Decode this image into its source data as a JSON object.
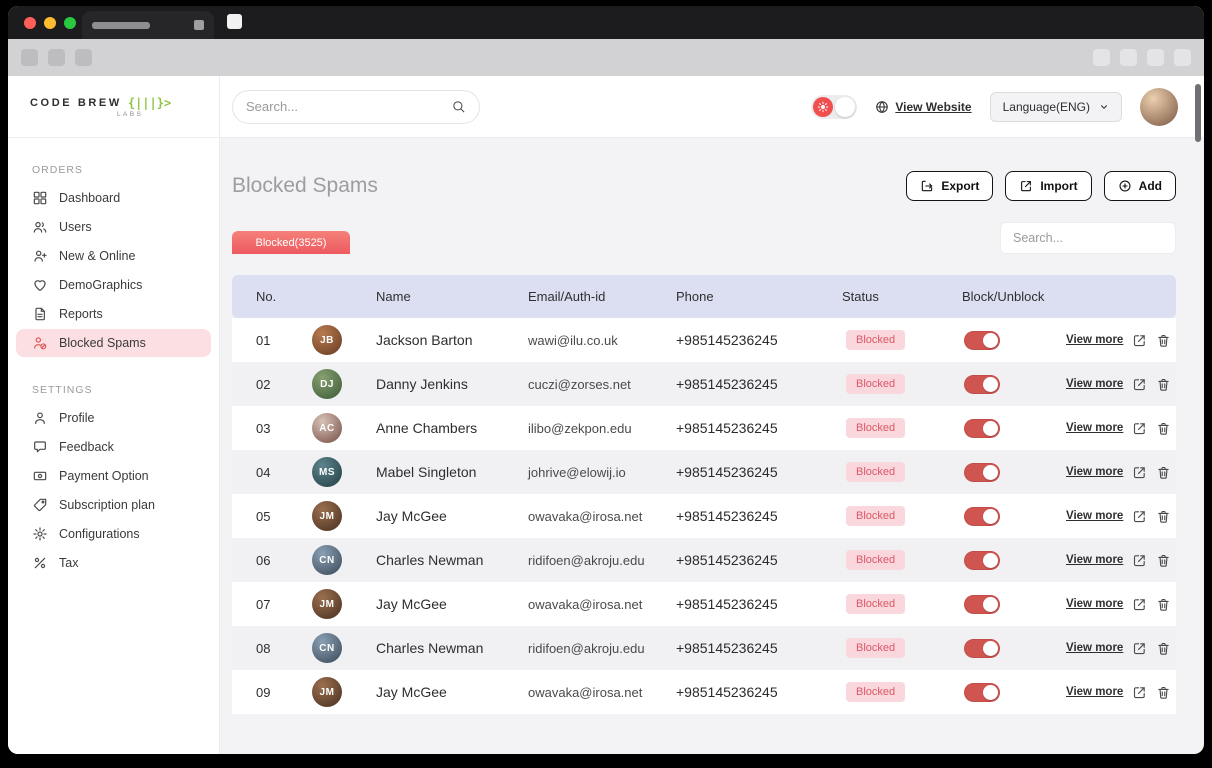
{
  "window": {
    "traffic_lights": [
      "close",
      "minimize",
      "zoom"
    ]
  },
  "sidebar": {
    "logo": {
      "text": "CODE BREW",
      "sub": "LABS",
      "mark": "{|||}>"
    },
    "sections": [
      {
        "label": "ORDERS",
        "items": [
          {
            "label": "Dashboard",
            "icon": "dashboard-icon",
            "active": false
          },
          {
            "label": "Users",
            "icon": "users-icon",
            "active": false
          },
          {
            "label": "New & Online",
            "icon": "user-plus-icon",
            "active": false
          },
          {
            "label": "DemoGraphics",
            "icon": "heart-icon",
            "active": false
          },
          {
            "label": "Reports",
            "icon": "report-icon",
            "active": false
          },
          {
            "label": "Blocked Spams",
            "icon": "user-block-icon",
            "active": true
          }
        ]
      },
      {
        "label": "SETTINGS",
        "items": [
          {
            "label": "Profile",
            "icon": "profile-icon",
            "active": false
          },
          {
            "label": "Feedback",
            "icon": "feedback-icon",
            "active": false
          },
          {
            "label": "Payment Option",
            "icon": "payment-icon",
            "active": false
          },
          {
            "label": "Subscription plan",
            "icon": "subscription-icon",
            "active": false
          },
          {
            "label": "Configurations",
            "icon": "configurations-icon",
            "active": false
          },
          {
            "label": "Tax",
            "icon": "tax-icon",
            "active": false
          }
        ]
      }
    ]
  },
  "topbar": {
    "search_placeholder": "Search...",
    "view_website": "View Website",
    "language": "Language(ENG)"
  },
  "page": {
    "title": "Blocked Spams",
    "export_label": "Export",
    "import_label": "Import",
    "add_label": "Add",
    "tab_label": "Blocked(3525)",
    "table_search_placeholder": "Search..."
  },
  "table": {
    "headers": {
      "no": "No.",
      "name": "Name",
      "email": "Email/Auth-id",
      "phone": "Phone",
      "status": "Status",
      "block": "Block/Unblock"
    },
    "view_more_label": "View more",
    "rows": [
      {
        "no": "01",
        "name": "Jackson Barton",
        "email": "wawi@ilu.co.uk",
        "phone": "+985145236245",
        "status": "Blocked",
        "avatar_bg": "#7a4a2e",
        "avatar_bg2": "#b97b4e"
      },
      {
        "no": "02",
        "name": "Danny Jenkins",
        "email": "cuczi@zorses.net",
        "phone": "+985145236245",
        "status": "Blocked",
        "avatar_bg": "#4e6b46",
        "avatar_bg2": "#86a06f"
      },
      {
        "no": "03",
        "name": "Anne Chambers",
        "email": "ilibo@zekpon.edu",
        "phone": "+985145236245",
        "status": "Blocked",
        "avatar_bg": "#8d6a60",
        "avatar_bg2": "#d8c2b8"
      },
      {
        "no": "04",
        "name": "Mabel Singleton",
        "email": "johrive@elowij.io",
        "phone": "+985145236245",
        "status": "Blocked",
        "avatar_bg": "#2f4f55",
        "avatar_bg2": "#5e858c"
      },
      {
        "no": "05",
        "name": "Jay McGee",
        "email": "owavaka@irosa.net",
        "phone": "+985145236245",
        "status": "Blocked",
        "avatar_bg": "#5d3f2c",
        "avatar_bg2": "#9a6f4e"
      },
      {
        "no": "06",
        "name": "Charles Newman",
        "email": "ridifoen@akroju.edu",
        "phone": "+985145236245",
        "status": "Blocked",
        "avatar_bg": "#4d5d6e",
        "avatar_bg2": "#8aa0b4"
      },
      {
        "no": "07",
        "name": "Jay McGee",
        "email": "owavaka@irosa.net",
        "phone": "+985145236245",
        "status": "Blocked",
        "avatar_bg": "#5d3f2c",
        "avatar_bg2": "#9a6f4e"
      },
      {
        "no": "08",
        "name": "Charles Newman",
        "email": "ridifoen@akroju.edu",
        "phone": "+985145236245",
        "status": "Blocked",
        "avatar_bg": "#4d5d6e",
        "avatar_bg2": "#8aa0b4"
      },
      {
        "no": "09",
        "name": "Jay McGee",
        "email": "owavaka@irosa.net",
        "phone": "+985145236245",
        "status": "Blocked",
        "avatar_bg": "#5d3f2c",
        "avatar_bg2": "#9a6f4e"
      }
    ]
  },
  "colors": {
    "accent_red": "#ed5a60",
    "badge_bg": "#f9d7dd",
    "badge_text": "#dd5868",
    "table_header_bg": "#dcdff2",
    "active_item_bg": "#fcdfe2",
    "logo_green": "#8bc540",
    "toggle_on": "#d05550"
  }
}
